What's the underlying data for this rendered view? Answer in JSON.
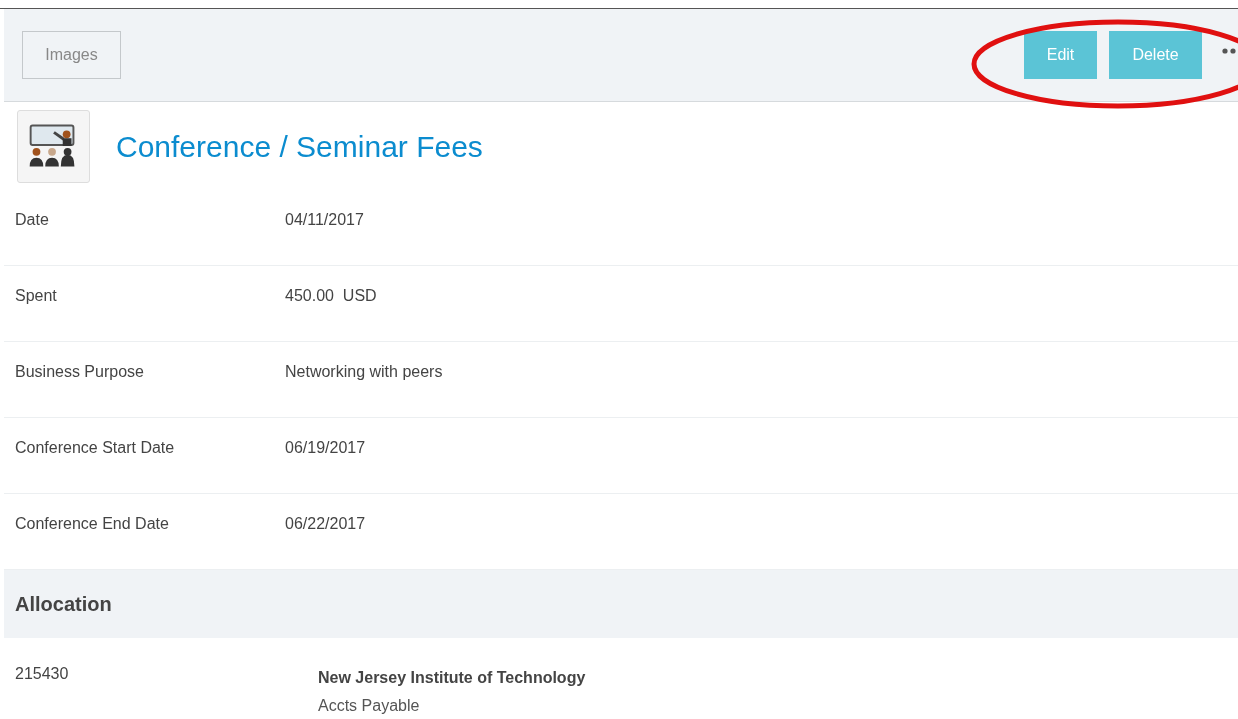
{
  "toolbar": {
    "images_button": "Images",
    "buttons": [
      "Edit",
      "Delete"
    ]
  },
  "title": "Conference / Seminar Fees",
  "fields": [
    {
      "label": "Date",
      "value": "04/11/2017"
    },
    {
      "label": "Spent",
      "value": "450.00  USD"
    },
    {
      "label": "Business Purpose",
      "value": "Networking with peers"
    },
    {
      "label": "Conference Start Date",
      "value": "06/19/2017"
    },
    {
      "label": "Conference End Date",
      "value": "06/22/2017"
    }
  ],
  "allocation": {
    "heading": "Allocation",
    "rows": [
      {
        "code": "215430",
        "name": "New Jersey Institute of Technology",
        "account": "Accts Payable"
      }
    ]
  }
}
